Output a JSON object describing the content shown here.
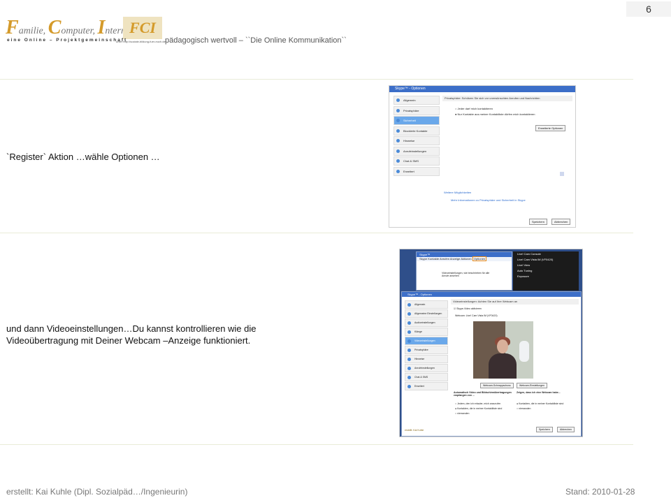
{
  "page_number": "6",
  "logo": {
    "cap_f": "F",
    "rest_f": "amilie,",
    "cap_c": "C",
    "rest_c": "omputer,",
    "cap_i": "I",
    "rest_i": "nternet-",
    "badge": "FCI",
    "tagline": "eine Online – Projektgemeinschaft",
    "url": "unter http://soziale-bildung-fuer-euch.de"
  },
  "header_title": "pädagogisch wertvoll – ``Die Online Kommunikation``",
  "step1_text": "`Register`   Aktion …wähle Optionen …",
  "step2_text": "und dann Videoeinstellungen…Du kannst kontrollieren wie die Videoübertragung mit Deiner Webcam –Anzeige funktioniert.",
  "footer_left": "erstellt: Kai Kuhle (Dipl. Sozialpäd…/Ingenieurin)",
  "footer_right": "Stand: 2010-01-28",
  "shot1": {
    "title": "Skype™ - Optionen",
    "sidebar": [
      "Allgemein",
      "Privatsphäre",
      "Sicherheit",
      "Blockierte Kontakte",
      "Hinweise",
      "Anrufeinstellungen",
      "Chat & SMS",
      "Erweitert"
    ],
    "active_index": 2,
    "panel_title": "Privatsphäre: Schützen Sie sich vor unerwünschten Anrufen und Nachrichten",
    "option_1": "Jeder darf mich kontaktieren",
    "option_2": "Nur Kontakte aus meiner Kontaktliste dürfen mich kontaktieren",
    "advanced_button": "Erweiterte Optionen",
    "more_link": "Weitere Möglichkeiten",
    "info_link": "Mehr Informationen zu Privatsphäre und Sicherheit in Skype",
    "save_button": "Speichern",
    "cancel_button": "Abbrechen"
  },
  "shot2": {
    "skype_title": "Skype™",
    "skype_menu": [
      "Skype",
      "Kontakte",
      "Anrufen",
      "Anzeige",
      "Aktionen",
      "Optionen"
    ],
    "skype_hint": "Videoeinstellungen, wie beschrieben für alle Anrufe ansehen",
    "console_title": "Live! Cam Console",
    "console_device": "Live! Cam Vista IM (VF0420)",
    "console_view": "Live! View",
    "console_tuning": "Auto Tuning",
    "console_exposure": "Exposure",
    "options_title": "Skype™ - Optionen",
    "sidebar": [
      "Allgemein",
      "Allgemeine Einstellungen",
      "Audioeinstellungen",
      "Klänge",
      "Videoeinstellungen",
      "Privatsphäre",
      "Hinweise",
      "Anrufeinstellungen",
      "Chat & SMS",
      "Erweitert"
    ],
    "active_index": 4,
    "panel_title": "Videoeinstellungen: Achten Sie auf Ihre Webcam an",
    "enable_label": "Skype-Video aktivieren",
    "webcam_label": "Webcam: Live! Cam Vista IM (VF0420)",
    "snapshot_button": "Webcam-Schnappschuss",
    "webcam_settings_button": "Webcam-Einstellungen",
    "auto_label": "Automatisch Video und Bildschirmübertragungen empfangen von ...",
    "show_label": "Zeigen, dass ich eine Webcam habe...",
    "left_options": [
      "Jedem, den ich erlaube, mich anzurufen",
      "Kontakten, die in meiner Kontaktliste sind",
      "niemanden"
    ],
    "right_options": [
      "Kontakten, die in meiner Kontaktliste sind",
      "niemanden"
    ],
    "footer_user": "erstellt: Kai Kuhle",
    "save_button": "Speichern",
    "cancel_button": "Abbrechen"
  }
}
